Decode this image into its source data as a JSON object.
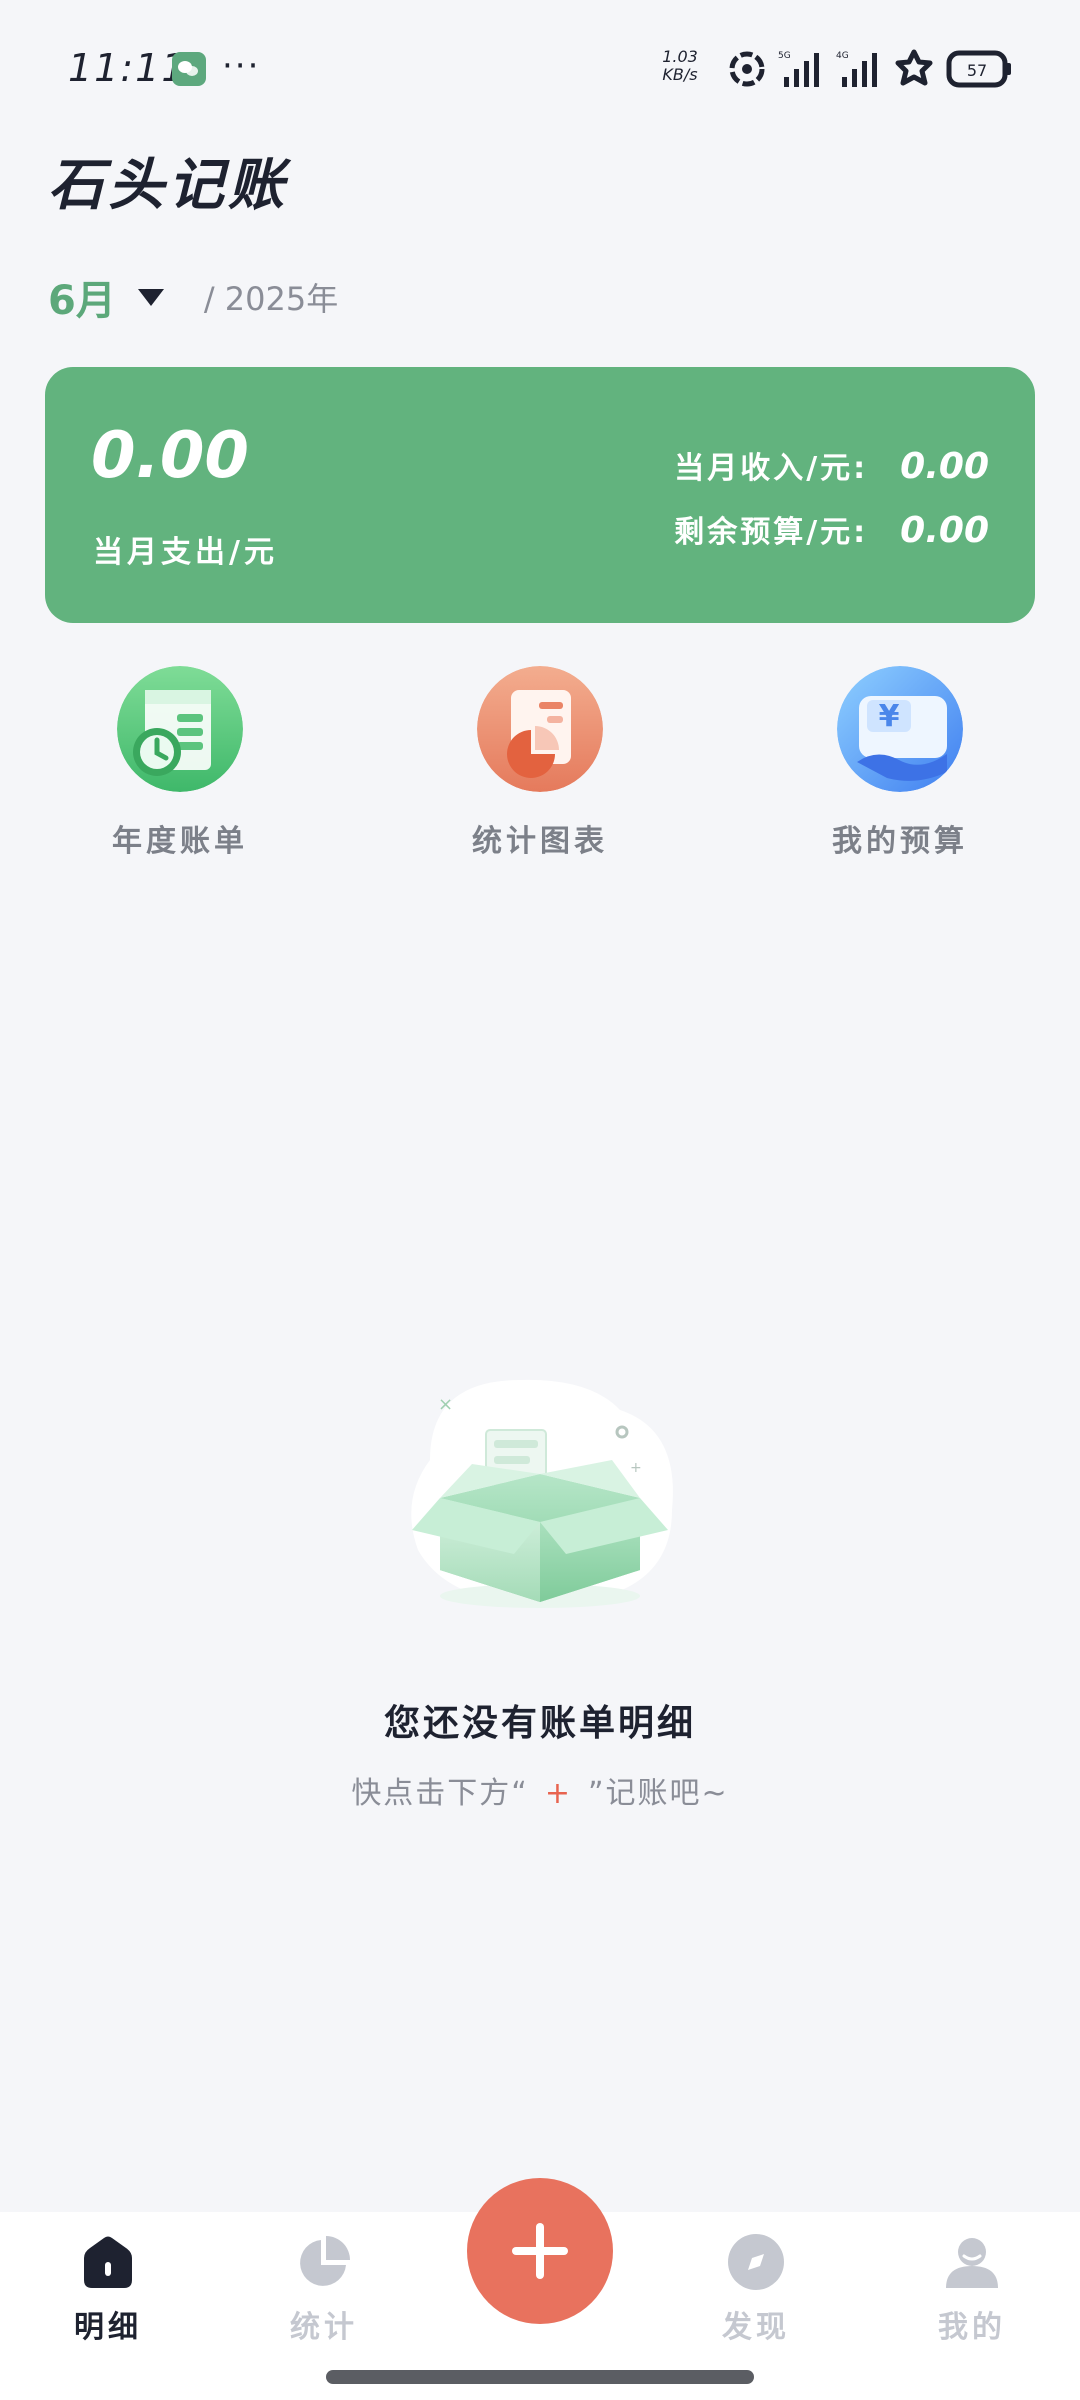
{
  "status_bar": {
    "time": "11:11",
    "more": "···",
    "net_speed_value": "1.03",
    "net_speed_unit": "KB/s",
    "signal_1_label": "5G",
    "signal_2_label": "4G",
    "battery": "57"
  },
  "header": {
    "title": "石头记账",
    "month": "6月",
    "year": "/ 2025年"
  },
  "summary": {
    "expense_value": "0.00",
    "expense_label": "当月支出/元",
    "income_label": "当月收入/元:",
    "income_value": "0.00",
    "budget_label": "剩余预算/元:",
    "budget_value": "0.00"
  },
  "shortcuts": [
    {
      "label": "年度账单",
      "icon": "annual-bill-icon",
      "color": "#5fc57e"
    },
    {
      "label": "统计图表",
      "icon": "chart-icon",
      "color": "#ee8a6c"
    },
    {
      "label": "我的预算",
      "icon": "budget-icon",
      "color": "#4d8df5"
    }
  ],
  "empty_state": {
    "title": "您还没有账单明细",
    "hint_before": "快点击下方“",
    "hint_plus": "+",
    "hint_after": "”记账吧~"
  },
  "bottom_nav": {
    "items": [
      {
        "label": "明细",
        "icon": "home-icon",
        "active": true
      },
      {
        "label": "统计",
        "icon": "pie-chart-icon",
        "active": false
      },
      {
        "label": "发现",
        "icon": "compass-icon",
        "active": false
      },
      {
        "label": "我的",
        "icon": "user-icon",
        "active": false
      }
    ],
    "add_icon": "plus-icon"
  },
  "colors": {
    "accent_green": "#62b37e",
    "add_button": "#e8725e",
    "background": "#f5f6f9"
  }
}
